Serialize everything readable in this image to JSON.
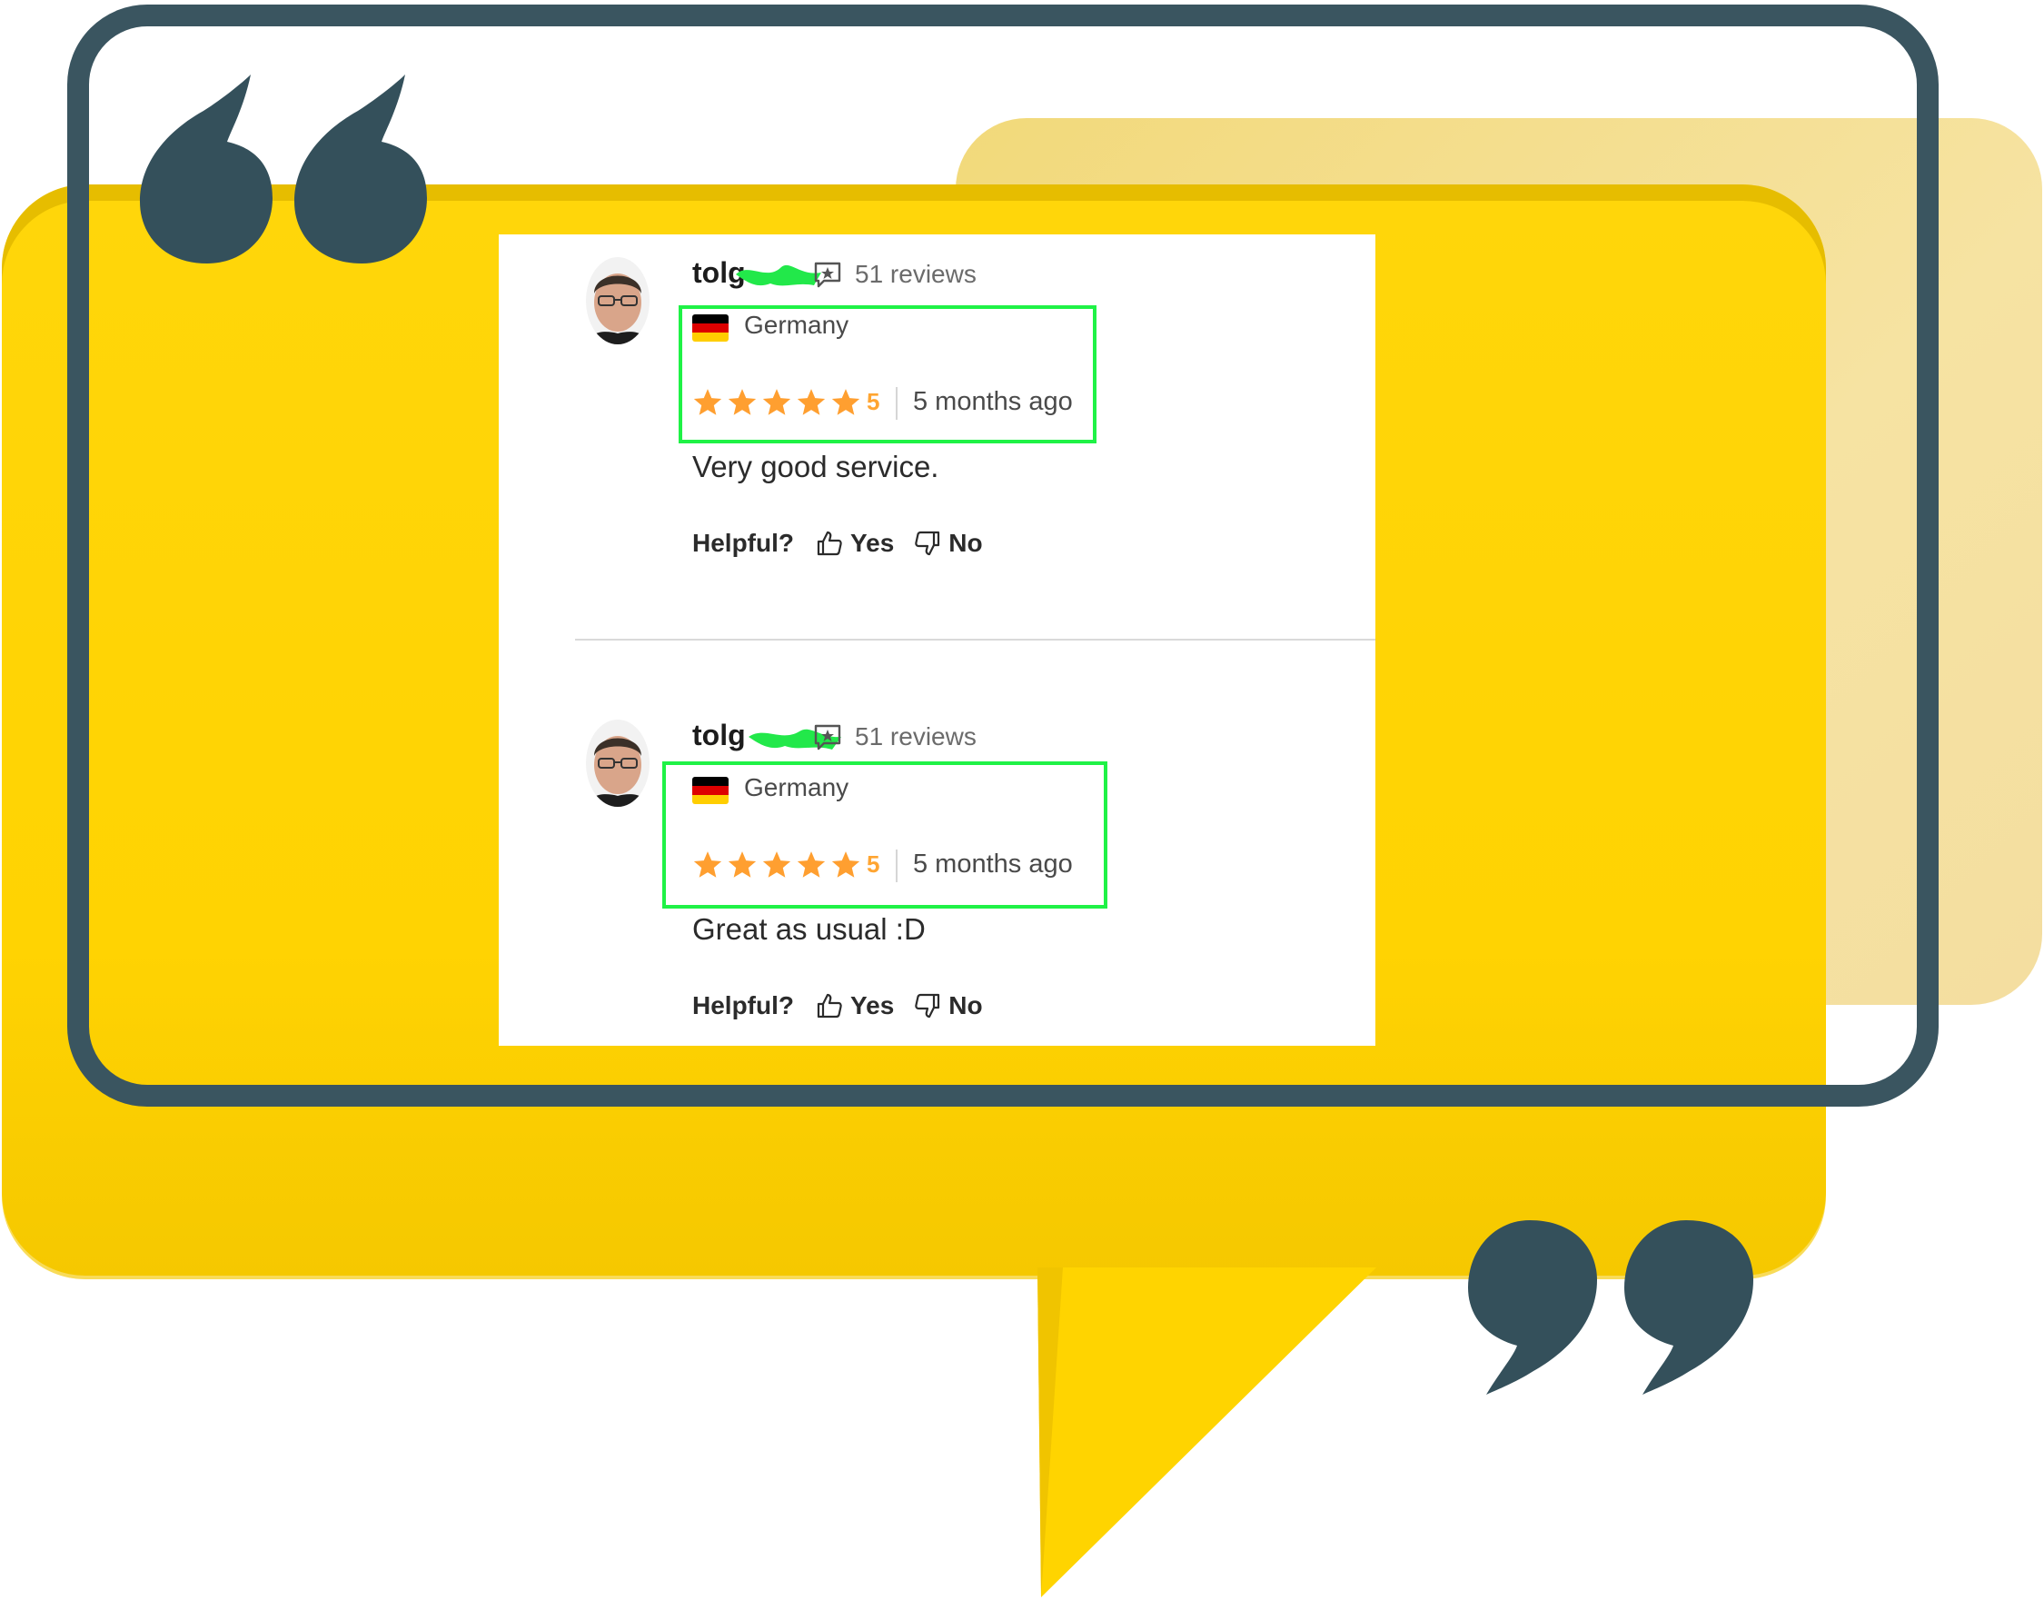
{
  "reviews": [
    {
      "author": "tolg",
      "review_count": "51 reviews",
      "country": "Germany",
      "rating": "5",
      "date": "5 months ago",
      "text": "Very good service.",
      "helpful_label": "Helpful?",
      "yes_label": "Yes",
      "no_label": "No"
    },
    {
      "author": "tolg",
      "review_count": "51 reviews",
      "country": "Germany",
      "rating": "5",
      "date": "5 months ago",
      "text": "Great as usual :D",
      "helpful_label": "Helpful?",
      "yes_label": "Yes",
      "no_label": "No"
    }
  ],
  "icons": {
    "open_quote": "left-double-quote-icon",
    "close_quote": "right-double-quote-icon",
    "review_count": "review-bubble-icon",
    "thumbs_up": "thumbs-up-icon",
    "thumbs_down": "thumbs-down-icon",
    "star": "star-icon",
    "flag": "germany-flag-icon"
  },
  "colors": {
    "bubble_yellow": "#ffd60a",
    "back_card": "#f4dea0",
    "frame": "#3a5560",
    "quote_marks": "#34505b",
    "star_orange": "#ff9f30",
    "highlight_green": "#1ff246"
  }
}
